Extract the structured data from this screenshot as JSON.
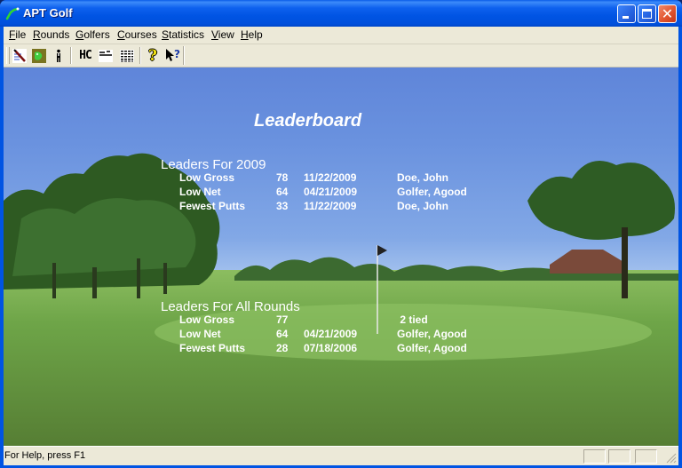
{
  "window": {
    "title": "APT Golf",
    "controls": {
      "minimize": "minimize",
      "maximize": "maximize",
      "close": "close"
    }
  },
  "menubar": {
    "items": [
      {
        "label": "File",
        "accel": "F",
        "rest": "ile"
      },
      {
        "label": "Rounds",
        "accel": "R",
        "rest": "ounds"
      },
      {
        "label": "Golfers",
        "accel": "G",
        "rest": "olfers"
      },
      {
        "label": "Courses",
        "accel": "C",
        "rest": "ourses"
      },
      {
        "label": "Statistics",
        "accel": "S",
        "rest": "tatistics"
      },
      {
        "label": "View",
        "accel": "V",
        "rest": "iew"
      },
      {
        "label": "Help",
        "accel": "H",
        "rest": "elp"
      }
    ]
  },
  "toolbar": {
    "buttons": [
      {
        "icon": "golf-club-icon",
        "tooltip": "Rounds"
      },
      {
        "icon": "golf-course-icon",
        "tooltip": "Courses"
      },
      {
        "icon": "golfer-icon",
        "tooltip": "Golfers"
      },
      {
        "icon": "handicap-icon",
        "label": "HC"
      },
      {
        "icon": "scorecard-icon"
      },
      {
        "icon": "table-grid-icon"
      },
      {
        "icon": "help-question-icon",
        "label": "?"
      },
      {
        "icon": "context-help-icon",
        "label": "?"
      }
    ]
  },
  "leaderboard": {
    "title": "Leaderboard",
    "sections": [
      {
        "title": "Leaders For 2009",
        "rows": [
          {
            "category": "Low Gross",
            "score": "78",
            "date": "11/22/2009",
            "golfer": "Doe, John"
          },
          {
            "category": "Low Net",
            "score": "64",
            "date": "04/21/2009",
            "golfer": "Golfer, Agood"
          },
          {
            "category": "Fewest Putts",
            "score": "33",
            "date": "11/22/2009",
            "golfer": "Doe, John"
          }
        ]
      },
      {
        "title": "Leaders For All Rounds",
        "rows": [
          {
            "category": "Low Gross",
            "score": "77",
            "date": "",
            "golfer": " 2 tied"
          },
          {
            "category": "Low Net",
            "score": "64",
            "date": "04/21/2009",
            "golfer": "Golfer, Agood"
          },
          {
            "category": "Fewest Putts",
            "score": "28",
            "date": "07/18/2006",
            "golfer": "Golfer, Agood"
          }
        ]
      }
    ]
  },
  "statusbar": {
    "text": "For Help, press F1"
  }
}
